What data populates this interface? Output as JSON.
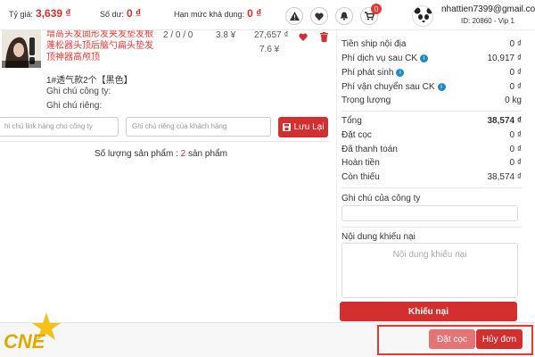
{
  "header": {
    "rate_label": "Tỷ giá:",
    "rate_value": "3,639 ₫",
    "balance_label": "Số dư:",
    "balance_value": "0 ₫",
    "credit_label": "Hạn mức khả dụng:",
    "credit_value": "0 ₫",
    "cart_badge": "0",
    "user_email": "nhattien7399@gmail.com",
    "user_id": "ID: 20860 - Vip 1"
  },
  "product": {
    "name": "增高头发固形发夹发垫发根蓬松器头顶后脑勺扁头垫发顶神器高颅顶",
    "quantity": "2 / 0 / 0",
    "unit_price": "3.8 ¥",
    "total_vnd": "27,657 ₫",
    "total_cny": "7.6 ¥",
    "variant": "1#透气款2个【黑色】",
    "company_note_label": "Ghi chú công ty:",
    "private_note_label": "Ghi chú riêng:",
    "company_link_placeholder": "hi chú link hàng cho công ty",
    "customer_note_placeholder": "Ghi chú riêng của khách hàng",
    "save_label": "Lưu Lại",
    "count_prefix": "Số lượng sản phẩm :",
    "count_value": "2",
    "count_suffix": "sản phẩm"
  },
  "summary": {
    "rows": [
      {
        "label": "Tiền ship nội địa",
        "value": "0 ₫"
      },
      {
        "label": "Phí dịch vụ sau CK",
        "value": "10,917 ₫"
      },
      {
        "label": "Phí phát sinh",
        "value": "0 ₫"
      },
      {
        "label": "Phí vận chuyển sau CK",
        "value": "0 ₫"
      },
      {
        "label": "Trọng lượng",
        "value": "0 kg"
      }
    ],
    "total_label": "Tổng",
    "total_value": "38,574 ₫",
    "rows2": [
      {
        "label": "Đặt cọc",
        "value": "0 ₫"
      },
      {
        "label": "Đã thanh toán",
        "value": "0 ₫"
      },
      {
        "label": "Hoàn tiền",
        "value": "0 ₫"
      },
      {
        "label": "Còn thiếu",
        "value": "38,574 ₫"
      }
    ],
    "company_note_title": "Ghi chú của công ty",
    "complaint_title": "Nội dung khiếu nại",
    "complaint_placeholder": "Nội dung khiếu nại",
    "complaint_button": "Khiếu nại"
  },
  "footer": {
    "logo_text": "CNE",
    "deposit_button": "Đặt cọc",
    "cancel_button": "Hủy đơn"
  },
  "colors": {
    "accent": "#d32f2f",
    "info": "#1e88c8"
  }
}
